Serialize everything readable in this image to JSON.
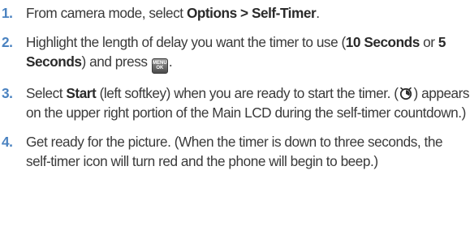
{
  "steps": [
    {
      "number": "1.",
      "t1": "From camera mode, select ",
      "b1": "Options > Self-Timer",
      "t2": "."
    },
    {
      "number": "2.",
      "t1": "Highlight the length of delay you want the timer to use (",
      "b1": "10 Seconds",
      "t2": " or ",
      "b2": "5 Seconds",
      "t3": ") and press ",
      "key_line1": "MENU",
      "key_line2": "OK",
      "t4": "."
    },
    {
      "number": "3.",
      "t1": "Select ",
      "b1": "Start",
      "t2": " (left softkey) when you are ready to start the timer. (",
      "icon": "self-timer-icon",
      "t3": ") appears on the upper right portion of the Main LCD during the self-timer countdown.)"
    },
    {
      "number": "4.",
      "t1": "Get ready for the picture. (When the timer is down to three seconds, the self-timer icon will turn red and the phone will begin to beep.)"
    }
  ]
}
